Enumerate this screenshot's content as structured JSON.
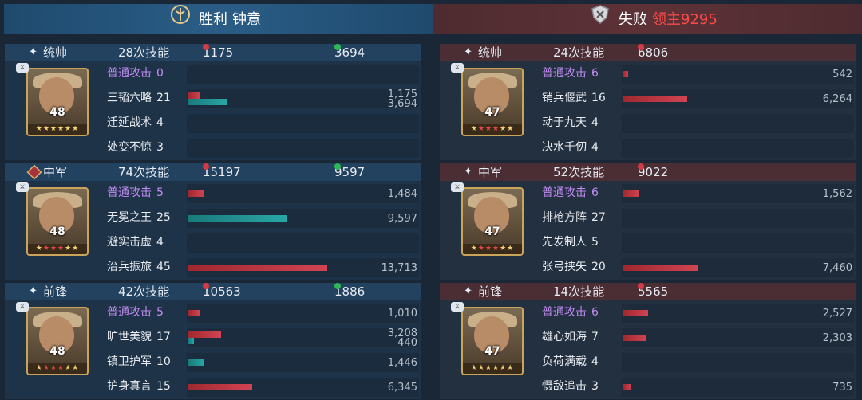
{
  "left_title": {
    "result": "胜利",
    "owner": "钟意"
  },
  "right_title": {
    "result": "失败",
    "owner": "领主9295"
  },
  "left_team": [
    {
      "role": "统帅",
      "skills_used": "28次技能",
      "damage": "1175",
      "heal": "3694",
      "level": "48",
      "skills": [
        {
          "name": "普通攻击",
          "count": "0",
          "purple": true
        },
        {
          "name": "三韬六略",
          "count": "21",
          "damage": "1,175",
          "damage_pct": 0.054,
          "heal": "3,694",
          "heal_pct": 0.17
        },
        {
          "name": "迁延战术",
          "count": "4"
        },
        {
          "name": "处变不惊",
          "count": "3"
        }
      ]
    },
    {
      "role": "中军",
      "skills_used": "74次技能",
      "damage": "15197",
      "heal": "9597",
      "level": "48",
      "skills": [
        {
          "name": "普通攻击",
          "count": "5",
          "purple": true,
          "damage": "1,484",
          "damage_pct": 0.07
        },
        {
          "name": "无冕之王",
          "count": "25",
          "heal": "9,597",
          "heal_pct": 0.43
        },
        {
          "name": "避实击虚",
          "count": "4"
        },
        {
          "name": "治兵振旅",
          "count": "45",
          "damage": "13,713",
          "damage_pct": 0.61
        }
      ]
    },
    {
      "role": "前锋",
      "skills_used": "42次技能",
      "damage": "10563",
      "heal": "1886",
      "level": "48",
      "skills": [
        {
          "name": "普通攻击",
          "count": "5",
          "purple": true,
          "damage": "1,010",
          "damage_pct": 0.05
        },
        {
          "name": "旷世美貌",
          "count": "17",
          "damage": "3,208",
          "damage_pct": 0.145,
          "heal": "440",
          "heal_pct": 0.025
        },
        {
          "name": "镇卫护军",
          "count": "10",
          "heal": "1,446",
          "heal_pct": 0.065
        },
        {
          "name": "护身真言",
          "count": "15",
          "damage": "6,345",
          "damage_pct": 0.28
        }
      ]
    }
  ],
  "right_team": [
    {
      "role": "统帅",
      "skills_used": "24次技能",
      "damage": "6806",
      "level": "47",
      "skills": [
        {
          "name": "普通攻击",
          "count": "6",
          "purple": true,
          "damage": "542",
          "damage_pct": 0.02
        },
        {
          "name": "销兵偃武",
          "count": "16",
          "damage": "6,264",
          "damage_pct": 0.28
        },
        {
          "name": "动于九天",
          "count": "4"
        },
        {
          "name": "决水千仞",
          "count": "4"
        }
      ]
    },
    {
      "role": "中军",
      "skills_used": "52次技能",
      "damage": "9022",
      "level": "47",
      "skills": [
        {
          "name": "普通攻击",
          "count": "6",
          "purple": true,
          "damage": "1,562",
          "damage_pct": 0.07
        },
        {
          "name": "排枪方阵",
          "count": "27"
        },
        {
          "name": "先发制人",
          "count": "5"
        },
        {
          "name": "张弓挟矢",
          "count": "20",
          "damage": "7,460",
          "damage_pct": 0.33
        }
      ]
    },
    {
      "role": "前锋",
      "skills_used": "14次技能",
      "damage": "5565",
      "level": "47",
      "skills": [
        {
          "name": "普通攻击",
          "count": "6",
          "purple": true,
          "damage": "2,527",
          "damage_pct": 0.11
        },
        {
          "name": "雄心如海",
          "count": "7",
          "damage": "2,303",
          "damage_pct": 0.1
        },
        {
          "name": "负荷满载",
          "count": "4"
        },
        {
          "name": "慑敌追击",
          "count": "3",
          "damage": "735",
          "damage_pct": 0.035
        }
      ]
    }
  ],
  "colors": {
    "win_banner": "#2a5d86",
    "lose_banner": "#5d3237",
    "damage": "#d24452",
    "heal": "#29a6a6",
    "loser_name": "#ff4a4a",
    "basic_attack": "#c38cf6"
  },
  "icons": {
    "win": "victory-shield-icon",
    "lose": "defeat-shield-icon",
    "star": "sparkle-star-icon",
    "mid": "diamond-banner-icon"
  }
}
